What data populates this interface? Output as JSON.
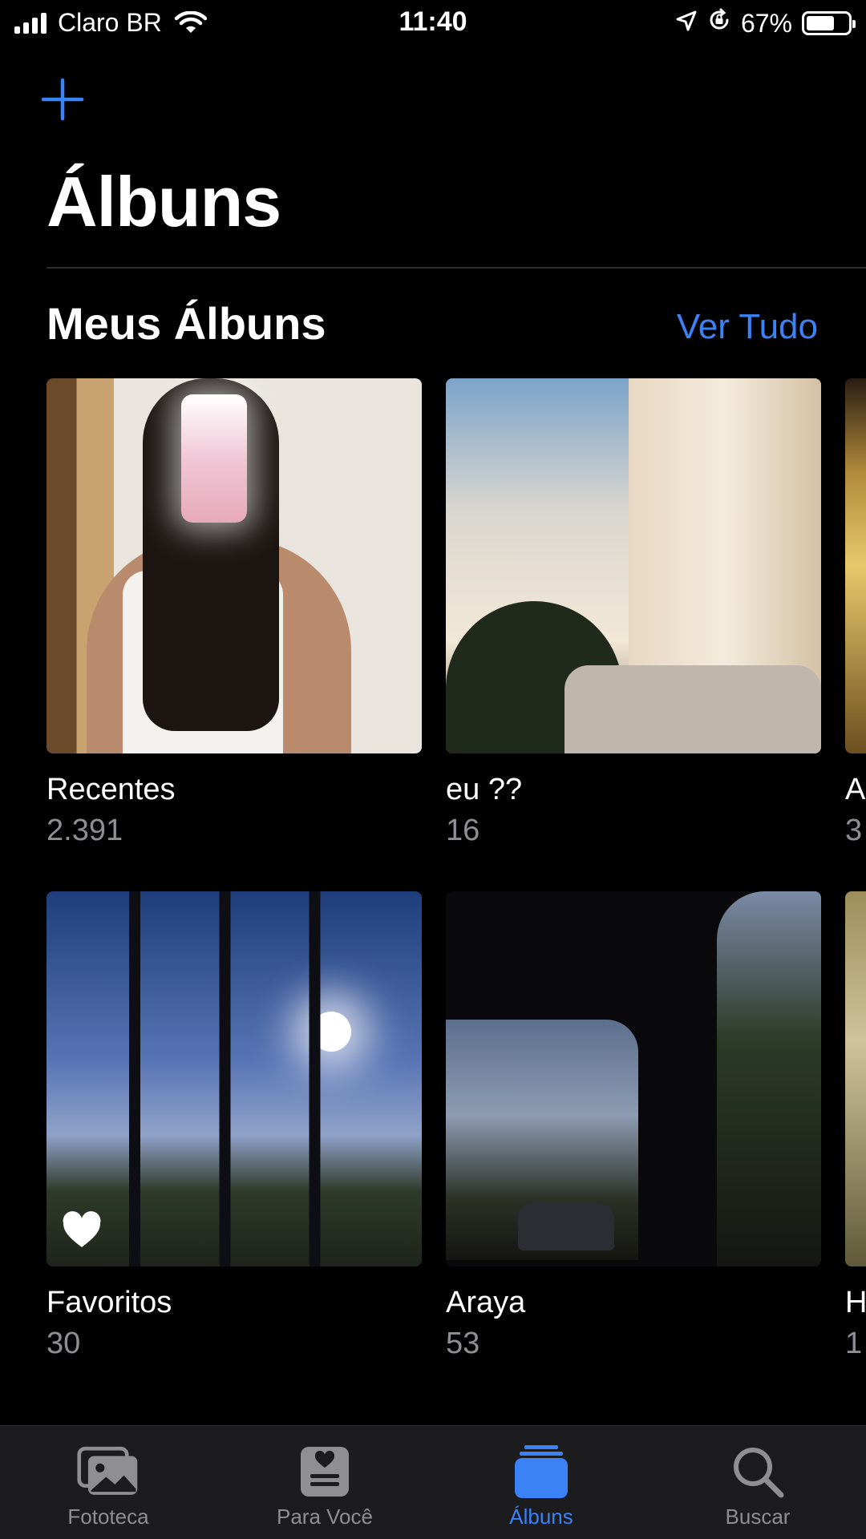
{
  "status_bar": {
    "carrier": "Claro BR",
    "time": "11:40",
    "battery": "67%",
    "battery_level": 0.67
  },
  "header": {
    "title": "Álbuns"
  },
  "section": {
    "title": "Meus Álbuns",
    "see_all": "Ver Tudo"
  },
  "albums": [
    {
      "name": "Recentes",
      "count": "2.391"
    },
    {
      "name": "eu ??",
      "count": "16"
    },
    {
      "name": "A",
      "count": "3"
    },
    {
      "name": "Favoritos",
      "count": "30"
    },
    {
      "name": "Araya",
      "count": "53"
    },
    {
      "name": "H",
      "count": "1"
    }
  ],
  "tab_bar": {
    "tabs": [
      {
        "label": "Fototeca",
        "icon": "photo-library-icon"
      },
      {
        "label": "Para Você",
        "icon": "for-you-icon"
      },
      {
        "label": "Álbuns",
        "icon": "albums-icon",
        "active": true
      },
      {
        "label": "Buscar",
        "icon": "search-icon"
      }
    ]
  },
  "colors": {
    "accent": "#3b82f6",
    "background": "#000000",
    "secondary_text": "#8e8e93",
    "tab_bar_bg": "#1c1c1e"
  }
}
